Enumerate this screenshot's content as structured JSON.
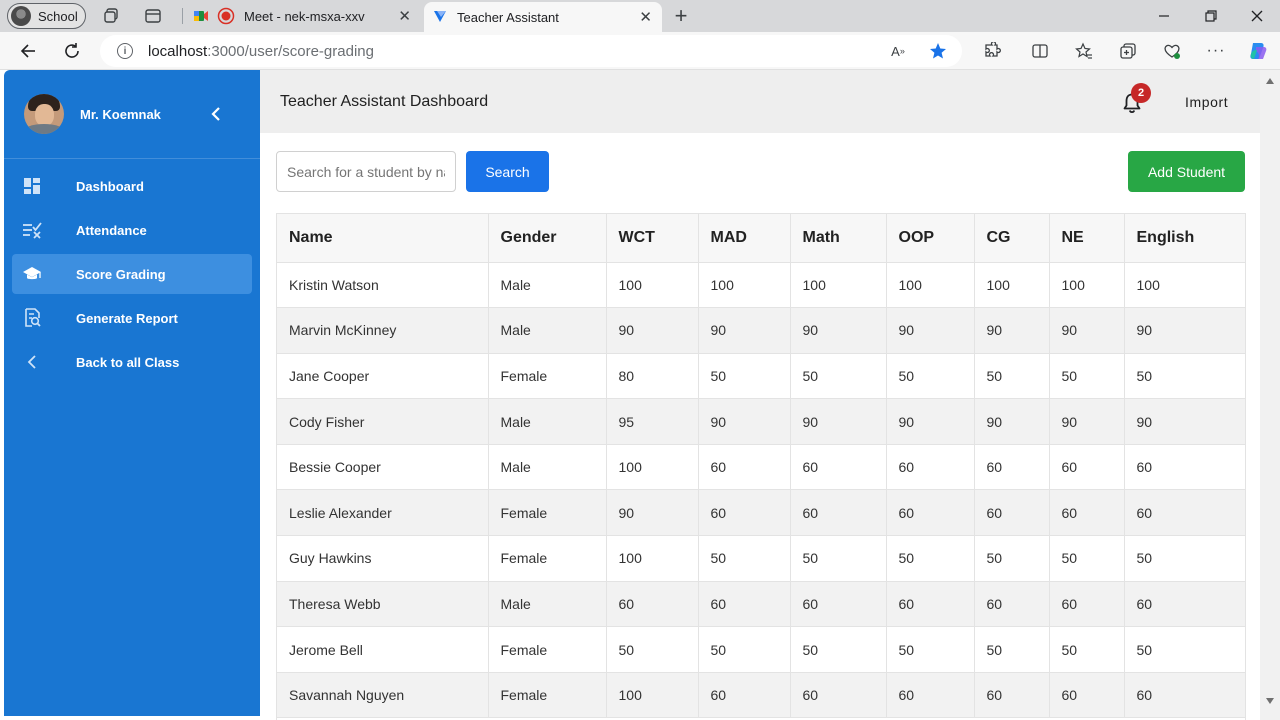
{
  "browser": {
    "profile_label": "School",
    "tabs": [
      {
        "title": "Meet - nek-msxa-xxv",
        "active": false
      },
      {
        "title": "Teacher Assistant",
        "active": true
      }
    ],
    "address": {
      "host": "localhost",
      "path": ":3000/user/score-grading"
    }
  },
  "sidebar": {
    "teacher_name": "Mr. Koemnak",
    "items": [
      {
        "label": "Dashboard",
        "icon": "dashboard-icon",
        "active": false
      },
      {
        "label": "Attendance",
        "icon": "attendance-icon",
        "active": false
      },
      {
        "label": "Score Grading",
        "icon": "graduation-cap-icon",
        "active": true
      },
      {
        "label": "Generate Report",
        "icon": "report-icon",
        "active": false
      },
      {
        "label": "Back to all Class",
        "icon": "chevron-left-icon",
        "active": false
      }
    ]
  },
  "header": {
    "title": "Teacher Assistant Dashboard",
    "notification_count": "2",
    "import_label": "Import"
  },
  "toolbar": {
    "search_placeholder": "Search for a student by name",
    "search_label": "Search",
    "add_label": "Add Student"
  },
  "table": {
    "columns": [
      "Name",
      "Gender",
      "WCT",
      "MAD",
      "Math",
      "OOP",
      "CG",
      "NE",
      "English"
    ],
    "rows": [
      [
        "Kristin Watson",
        "Male",
        "100",
        "100",
        "100",
        "100",
        "100",
        "100",
        "100"
      ],
      [
        "Marvin McKinney",
        "Male",
        "90",
        "90",
        "90",
        "90",
        "90",
        "90",
        "90"
      ],
      [
        "Jane Cooper",
        "Female",
        "80",
        "50",
        "50",
        "50",
        "50",
        "50",
        "50"
      ],
      [
        "Cody Fisher",
        "Male",
        "95",
        "90",
        "90",
        "90",
        "90",
        "90",
        "90"
      ],
      [
        "Bessie Cooper",
        "Male",
        "100",
        "60",
        "60",
        "60",
        "60",
        "60",
        "60"
      ],
      [
        "Leslie Alexander",
        "Female",
        "90",
        "60",
        "60",
        "60",
        "60",
        "60",
        "60"
      ],
      [
        "Guy Hawkins",
        "Female",
        "100",
        "50",
        "50",
        "50",
        "50",
        "50",
        "50"
      ],
      [
        "Theresa Webb",
        "Male",
        "60",
        "60",
        "60",
        "60",
        "60",
        "60",
        "60"
      ],
      [
        "Jerome Bell",
        "Female",
        "50",
        "50",
        "50",
        "50",
        "50",
        "50",
        "50"
      ],
      [
        "Savannah Nguyen",
        "Female",
        "100",
        "60",
        "60",
        "60",
        "60",
        "60",
        "60"
      ]
    ]
  },
  "colors": {
    "sidebar": "#1976d2",
    "sidebar_active": "#3d8fe0",
    "search_button": "#1a73e8",
    "add_button": "#28a745",
    "badge": "#c62828"
  }
}
